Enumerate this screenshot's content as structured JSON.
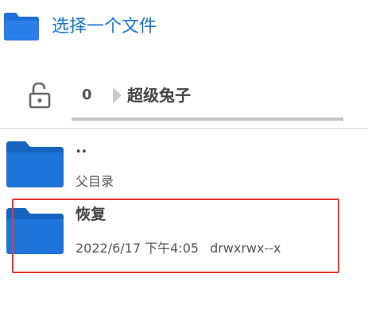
{
  "header": {
    "title": "选择一个文件",
    "icon": "folder-icon"
  },
  "pathbar": {
    "lock_icon": "lock-open-icon",
    "root": "0",
    "folder": "超级兔子"
  },
  "files": [
    {
      "name": "..",
      "subtitle": "父目录",
      "icon": "folder-icon"
    },
    {
      "name": "恢复",
      "date": "2022/6/17 下午4:05",
      "permissions": "drwxrwx--x",
      "icon": "folder-icon"
    }
  ],
  "colors": {
    "accent": "#1976d2",
    "folder": "#1e6fd9",
    "highlight": "#e53935"
  }
}
